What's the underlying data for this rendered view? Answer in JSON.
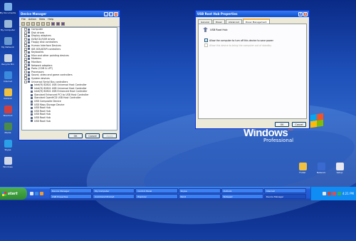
{
  "desktop": {
    "icons": [
      {
        "label": "My Documents",
        "color": "#7ab0e8"
      },
      {
        "label": "My Computer",
        "color": "#9ab8d8"
      },
      {
        "label": "My Network",
        "color": "#6a9ad0"
      },
      {
        "label": "Recycle Bin",
        "color": "#c8d4e4"
      },
      {
        "label": "Internet",
        "color": "#3a8ade"
      },
      {
        "label": "Outlook",
        "color": "#f0c040"
      },
      {
        "label": "Shortcut",
        "color": "#d04040"
      },
      {
        "label": "Media",
        "color": "#4a8a4a"
      },
      {
        "label": "Skype",
        "color": "#2aa0e8"
      },
      {
        "label": "Windows",
        "color": "#d0d8e8"
      }
    ],
    "right_icons": [
      {
        "label": "Folder",
        "color": "#f0c040"
      },
      {
        "label": "Network",
        "color": "#3a6ad0"
      },
      {
        "label": "Setup",
        "color": "#e8e8f0"
      }
    ],
    "logo": {
      "brand": "Microsoft®",
      "name": "Windows",
      "sup": "XP",
      "edition": "Professional"
    }
  },
  "device_manager": {
    "title": "Device Manager",
    "menu": [
      "File",
      "Action",
      "View",
      "Help"
    ],
    "tree": [
      "Computer",
      "Disk drives",
      "Display adapters",
      "DVD/CD-ROM drives",
      "Floppy disk controllers",
      "Human Interface Devices",
      "IDE ATA/ATAPI controllers",
      "Keyboards",
      "Mice and other pointing devices",
      "Modems",
      "Monitors",
      "Network adapters",
      "Ports (COM & LPT)",
      "Processors",
      "Sound, video and game controllers",
      "System devices",
      "Universal Serial Bus controllers",
      "Intel(R) 82801 USB Universal Host Controller",
      "Intel(R) 82801 USB Universal Host Controller",
      "Intel(R) 82801 USB Enhanced Host Controller",
      "Standard Enhanced PCI to USB Host Controller",
      "Standard OpenHCD USB Host Controller",
      "USB Composite Device",
      "USB Mass Storage Device",
      "USB Root Hub",
      "USB Root Hub",
      "USB Root Hub",
      "USB Root Hub",
      "USB Root Hub"
    ],
    "buttons": {
      "ok": "OK",
      "cancel": "Cancel",
      "apply": "Apply"
    }
  },
  "usb_props": {
    "title": "USB Root Hub Properties",
    "tabs": [
      "General",
      "Power",
      "Advanced",
      "Power Management"
    ],
    "active_tab": "Power Management",
    "heading": "USB Root Hub",
    "opt1": "Allow the computer to turn off this device to save power",
    "opt2": "Allow this device to bring the computer out of standby",
    "buttons": {
      "ok": "OK",
      "cancel": "Cancel"
    }
  },
  "taskbar": {
    "start": "start",
    "tasks": [
      "Device Manager",
      "My Computer",
      "Control Panel",
      "Skype",
      "Outlook",
      "Internet",
      "USB Properties",
      "Command Prompt",
      "Explorer",
      "Paint",
      "Notepad",
      "Device Manager"
    ],
    "clock": "4:21 PM"
  }
}
